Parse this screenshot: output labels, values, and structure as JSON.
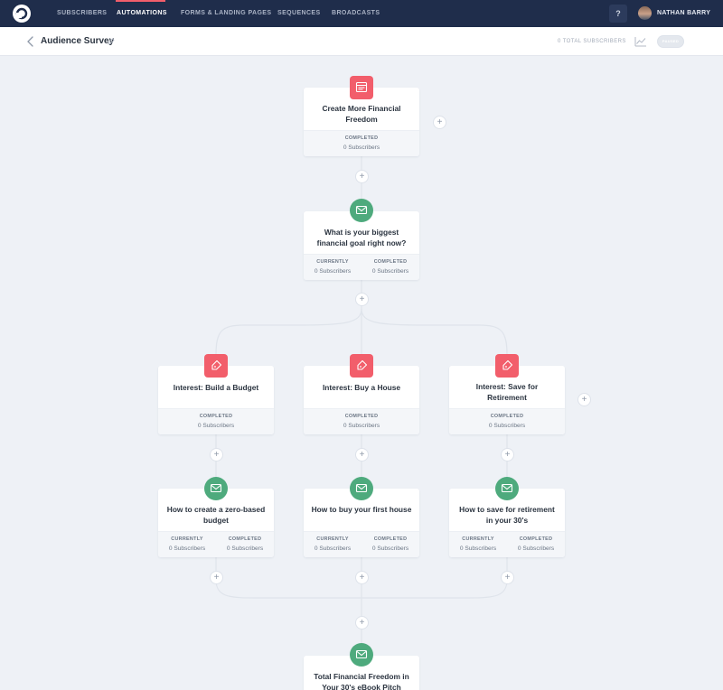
{
  "nav": {
    "items": [
      "SUBSCRIBERS",
      "AUTOMATIONS",
      "FORMS & LANDING PAGES",
      "SEQUENCES",
      "BROADCASTS"
    ],
    "active": "AUTOMATIONS",
    "help_label": "?",
    "user_name": "NATHAN BARRY"
  },
  "header": {
    "title": "Audience Survey",
    "total_subscribers": "0 TOTAL SUBSCRIBERS",
    "toggle_label": "PAUSED"
  },
  "colors": {
    "nav_bg": "#1f2d4b",
    "accent_red": "#f25e6b",
    "event_red": "#f25e6b",
    "email_green": "#4eaa7d",
    "canvas": "#eef1f6"
  },
  "plus_label": "+",
  "nodes": {
    "trigger": {
      "title": "Create More Financial Freedom",
      "icon": "form-icon",
      "stats": [
        {
          "label": "COMPLETED",
          "value": "0 Subscribers"
        }
      ]
    },
    "survey_email": {
      "title": "What is your biggest financial goal right now?",
      "icon": "email-icon",
      "stats": [
        {
          "label": "CURRENTLY",
          "value": "0 Subscribers"
        },
        {
          "label": "COMPLETED",
          "value": "0 Subscribers"
        }
      ]
    },
    "tag_budget": {
      "title": "Interest: Build a Budget",
      "icon": "tag-icon",
      "stats": [
        {
          "label": "COMPLETED",
          "value": "0 Subscribers"
        }
      ]
    },
    "tag_house": {
      "title": "Interest: Buy a House",
      "icon": "tag-icon",
      "stats": [
        {
          "label": "COMPLETED",
          "value": "0 Subscribers"
        }
      ]
    },
    "tag_retire": {
      "title": "Interest: Save for Retirement",
      "icon": "tag-icon",
      "stats": [
        {
          "label": "COMPLETED",
          "value": "0 Subscribers"
        }
      ]
    },
    "email_budget": {
      "title": "How to create a zero-based budget",
      "icon": "email-icon",
      "stats": [
        {
          "label": "CURRENTLY",
          "value": "0 Subscribers"
        },
        {
          "label": "COMPLETED",
          "value": "0 Subscribers"
        }
      ]
    },
    "email_house": {
      "title": "How to buy your first house",
      "icon": "email-icon",
      "stats": [
        {
          "label": "CURRENTLY",
          "value": "0 Subscribers"
        },
        {
          "label": "COMPLETED",
          "value": "0 Subscribers"
        }
      ]
    },
    "email_retire": {
      "title": "How to save for retirement in your 30's",
      "icon": "email-icon",
      "stats": [
        {
          "label": "CURRENTLY",
          "value": "0 Subscribers"
        },
        {
          "label": "COMPLETED",
          "value": "0 Subscribers"
        }
      ]
    },
    "pitch": {
      "title": "Total Financial Freedom in Your 30's eBook Pitch",
      "icon": "email-icon",
      "stats": []
    }
  }
}
